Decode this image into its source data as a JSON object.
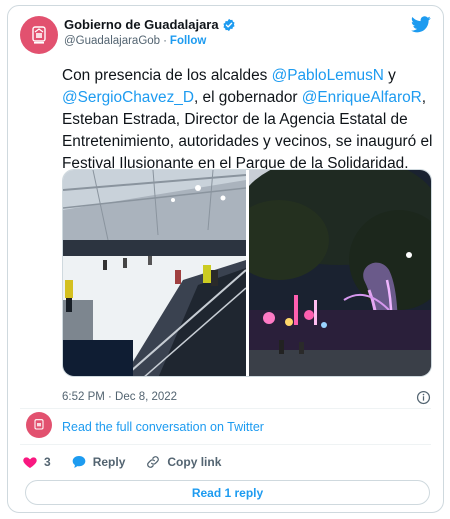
{
  "author": {
    "display_name": "Gobierno de Guadalajara",
    "handle": "@GuadalajaraGob",
    "separator": "·",
    "follow_label": "Follow"
  },
  "tweet": {
    "text_parts": [
      "Con presencia de los alcaldes ",
      "@PabloLemusN",
      " y ",
      "@SergioChavez_D",
      ", el gobernador ",
      "@EnriqueAlfaroR",
      ", Esteban Estrada, Director de la Agencia Estatal de Entretenimiento, autoridades y vecinos, se inauguró el Festival Ilusionante en el Parque de la Solidaridad."
    ],
    "timestamp": "6:52 PM · Dec 8, 2022"
  },
  "conversation": {
    "read_full_label": "Read the full conversation on Twitter"
  },
  "actions": {
    "like_count": "3",
    "reply_label": "Reply",
    "copy_link_label": "Copy link"
  },
  "read_reply_label": "Read 1 reply",
  "colors": {
    "accent": "#1d9bf0",
    "like": "#f91880",
    "avatar_bg": "#e2516f"
  },
  "icons": [
    "verified-badge-icon",
    "twitter-bird-icon",
    "info-icon",
    "heart-icon",
    "reply-bubble-icon",
    "link-icon"
  ]
}
